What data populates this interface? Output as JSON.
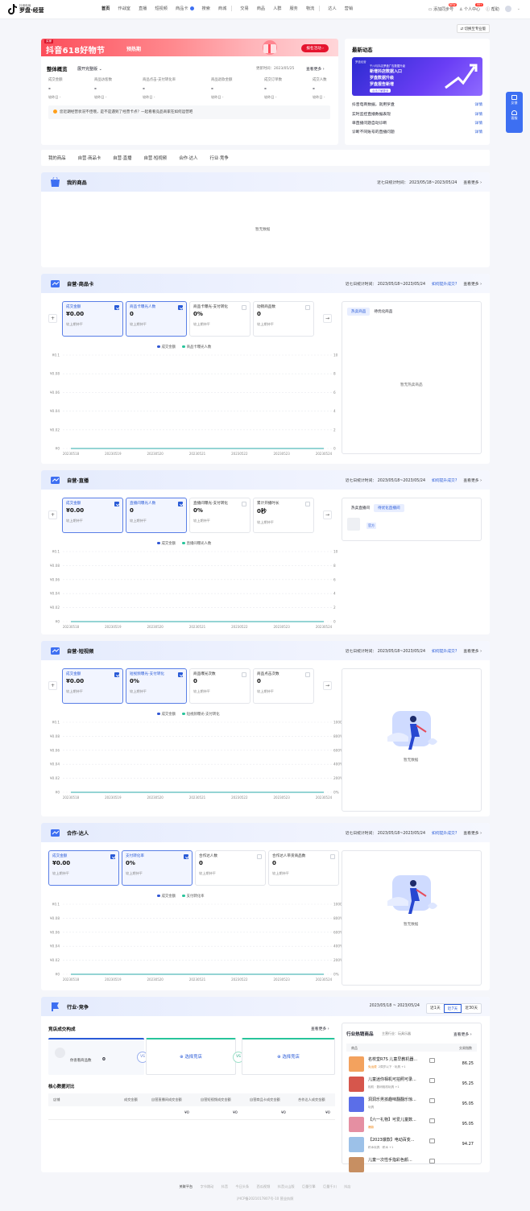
{
  "brand": {
    "line1": "抖音电商",
    "line2": "罗盘·经营"
  },
  "nav": {
    "items": [
      "首页",
      "作战室",
      "直播",
      "短视频",
      "商品卡",
      "搜索",
      "商城",
      "交易",
      "商品",
      "人群",
      "服务",
      "物流",
      "达人",
      "营销"
    ],
    "right": {
      "add_account": "添加同步号",
      "badge_new": "NEW",
      "personal": "个人中心",
      "badge_count": "99+",
      "help": "帮助"
    }
  },
  "switch_pro": "⇄ 切换至专业版",
  "banner": {
    "tag": "买家",
    "title": "抖音618好物节",
    "subtitle": "预热期",
    "cta": "报名活动 ›"
  },
  "overview": {
    "title": "整体概览",
    "version": "展开完整版 ⌄",
    "update_label": "更新时间：",
    "update_time": "2023/05/25",
    "more": "查看更多 ›",
    "metrics": [
      {
        "label": "成交金额",
        "value": "-",
        "compare": "较昨日 -"
      },
      {
        "label": "商品访客数",
        "value": "-",
        "compare": "较昨日 -"
      },
      {
        "label": "商品点击-支付转化率",
        "value": "-",
        "compare": "较昨日 -"
      },
      {
        "label": "商品退款金额",
        "value": "-",
        "compare": "较昨日 -"
      },
      {
        "label": "成交订单数",
        "value": "-",
        "compare": "较昨日 -"
      },
      {
        "label": "成交人数",
        "value": "-",
        "compare": "较昨日 -"
      }
    ],
    "tip": "您近期经营状况不佳哦，是不是遇到了经营卡点？一起看看竞品商家在如何运营吧"
  },
  "news": {
    "title": "最新动态",
    "promo": {
      "top": "罗盘经营",
      "head": "千川与抖店罗盘广告数据升级",
      "lines": [
        "新增抖店数据入口",
        "罗盘数据升级",
        "罗盘报告新增"
      ],
      "btn": "点击了解更多"
    },
    "items": [
      {
        "text": "抖音电商数据，就用罗盘",
        "link": "详情"
      },
      {
        "text": "实时监控直播数据表现",
        "link": "详情"
      },
      {
        "text": "单直播问题自动诊断",
        "link": "详情"
      },
      {
        "text": "诊断不同账号的直播问题",
        "link": "详情"
      }
    ]
  },
  "float": {
    "feedback": "反馈",
    "service": "客服"
  },
  "tabs": [
    "我的商品",
    "自营·商品卡",
    "自营·直播",
    "自营·短视频",
    "合作·达人",
    "行业·竞争"
  ],
  "period": "近七日统计时间： 2023/05/18~2023/05/24",
  "how_to": "如何提升成交?",
  "more": "查看更多 ›",
  "myprod": {
    "title": "我的商品",
    "empty": "暂无数据"
  },
  "dates": [
    "20230518",
    "20230519",
    "20230520",
    "20230521",
    "20230522",
    "20230523",
    "20230524"
  ],
  "card": {
    "title": "自营·商品卡",
    "metrics": [
      {
        "label": "成交金额",
        "value": "¥0.00",
        "compare": "较上期持平",
        "checked": true
      },
      {
        "label": "商品卡曝光人数",
        "value": "0",
        "compare": "较上期持平",
        "checked": true
      },
      {
        "label": "商品卡曝光-支付转化",
        "value": "0%",
        "compare": "较上期持平",
        "checked": false
      },
      {
        "label": "动销商品数",
        "value": "0",
        "compare": "较上期持平",
        "checked": false
      }
    ],
    "legend": [
      "成交金额",
      "商品卡曝光人数"
    ],
    "yleft": [
      "¥0.1",
      "¥0.08",
      "¥0.06",
      "¥0.04",
      "¥0.02",
      "¥0"
    ],
    "yright": [
      "10",
      "8",
      "6",
      "4",
      "2",
      "0"
    ],
    "tabs": [
      "热卖商品",
      "待优化商品"
    ],
    "empty": "暂无热卖商品"
  },
  "live": {
    "title": "自营·直播",
    "metrics": [
      {
        "label": "成交金额",
        "value": "¥0.00",
        "compare": "较上期持平",
        "checked": true
      },
      {
        "label": "直播间曝光人数",
        "value": "0",
        "compare": "较上期持平",
        "checked": true
      },
      {
        "label": "直播间曝光-支付转化",
        "value": "0%",
        "compare": "较上期持平",
        "checked": false
      },
      {
        "label": "累计开播时长",
        "value": "0秒",
        "compare": "较上期持平",
        "checked": false
      }
    ],
    "legend": [
      "成交金额",
      "直播间曝光人数"
    ],
    "yleft": [
      "¥0.1",
      "¥0.08",
      "¥0.06",
      "¥0.04",
      "¥0.02",
      "¥0"
    ],
    "yright": [
      "10",
      "8",
      "6",
      "4",
      "2",
      "0"
    ],
    "tabs": [
      "热卖直播间",
      "待优化直播间"
    ],
    "tag": "官方"
  },
  "video": {
    "title": "自营·短视频",
    "metrics": [
      {
        "label": "成交金额",
        "value": "¥0.00",
        "compare": "较上期持平",
        "checked": true
      },
      {
        "label": "短视频曝光-支付转化",
        "value": "0%",
        "compare": "较上期持平",
        "checked": true
      },
      {
        "label": "商品曝光次数",
        "value": "0",
        "compare": "较上期持平",
        "checked": false
      },
      {
        "label": "商品点击次数",
        "value": "0",
        "compare": "较上期持平",
        "checked": false
      }
    ],
    "legend": [
      "成交金额",
      "短视频曝光-支付转化"
    ],
    "yleft": [
      "¥0.1",
      "¥0.08",
      "¥0.06",
      "¥0.04",
      "¥0.02",
      "¥0"
    ],
    "yright": [
      "1000%",
      "800%",
      "600%",
      "400%",
      "200%",
      "0%"
    ],
    "empty": "暂无数据"
  },
  "talent": {
    "title": "合作·达人",
    "metrics": [
      {
        "label": "成交金额",
        "value": "¥0.00",
        "compare": "较上期持平",
        "checked": true
      },
      {
        "label": "支付转化率",
        "value": "0%",
        "compare": "较上期持平",
        "checked": true
      },
      {
        "label": "合作达人数",
        "value": "0",
        "compare": "较上期持平",
        "checked": false
      },
      {
        "label": "合作达人带货商品数",
        "value": "0",
        "compare": "较上期持平",
        "checked": false
      }
    ],
    "legend": [
      "成交金额",
      "支付转化率"
    ],
    "yleft": [
      "¥0.1",
      "¥0.08",
      "¥0.06",
      "¥0.04",
      "¥0.02",
      "¥0"
    ],
    "yright": [
      "1000%",
      "800%",
      "600%",
      "400%",
      "200%",
      "0%"
    ],
    "empty": "暂无数据"
  },
  "industry": {
    "title": "行业·竞争",
    "range": "2023/05/18 ~ 2023/05/24",
    "periods": [
      "近1天",
      "近7天",
      "近30天"
    ],
    "store_title": "竞店成交构成",
    "more": "查看更多 ›",
    "mystore": {
      "name": "你查看商品数",
      "value": "0"
    },
    "vs": "VS",
    "select": "选择竞店",
    "core_title": "核心数据对比",
    "cols": [
      "店铺",
      "成交金额",
      "自营直播间成交金额",
      "自营短视频成交金额",
      "自营商品卡成交金额",
      "合作达人成交金额"
    ],
    "row": [
      "",
      "",
      "¥0",
      "¥0",
      "¥0",
      "¥0"
    ],
    "hot": {
      "title": "行业热销商品",
      "category": "主营行业：",
      "cat_value": "玩具乐器",
      "more": "查看更多 ›",
      "col1": "商品",
      "col2": "交易指数",
      "items": [
        {
          "name": "名校堂R7S 儿童早教机器...",
          "sub": "2周岁以下 · 玩具 +1",
          "tag": "免运费",
          "value": "86.25"
        },
        {
          "name": "儿童迷你相机可拍照可录...",
          "sub": "相机 · 数码相机玩具 +1",
          "tag": "",
          "value": "95.25"
        },
        {
          "name": "洞洞乐男孩趣味翻翻乐惊...",
          "sub": "玩具",
          "tag": "",
          "value": "95.05"
        },
        {
          "name": "【六一礼物】可爱儿童数...",
          "sub": "",
          "tag": "爆款",
          "value": "95.05"
        },
        {
          "name": "【2023爆款】电动百变...",
          "sub": "积木玩具 · 积木 +1",
          "tag": "",
          "value": "94.27"
        },
        {
          "name": "儿童一次性手指彩色颜...",
          "sub": "",
          "tag": "",
          "value": ""
        }
      ]
    }
  },
  "footer": {
    "links": [
      "关联平台",
      "字节跳动",
      "抖音",
      "今日头条",
      "西瓜视频",
      "抖音火山版",
      "巨量引擎",
      "巨量千川",
      "抖店"
    ],
    "icp": "沪ICP备2021017807号-10    营业执照"
  },
  "colors": {
    "primary": "#2a5bd7",
    "series_blue": "#3056d3",
    "series_teal": "#27c49b",
    "banner": "#fc4d5a"
  }
}
